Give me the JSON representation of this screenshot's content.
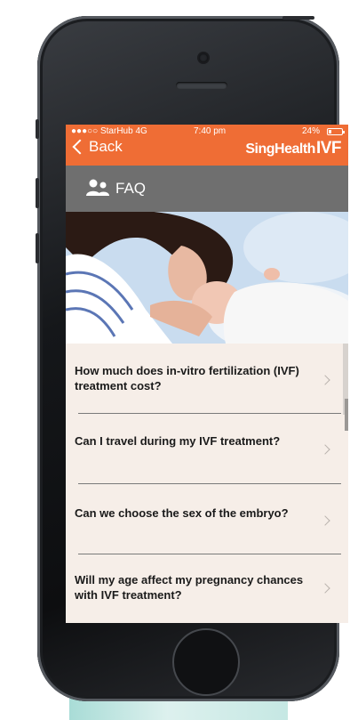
{
  "status_bar": {
    "carrier": "●●●○○ StarHub  4G",
    "time": "7:40 pm",
    "battery": "24%",
    "battery_level": 0.24
  },
  "header": {
    "back_label": "Back",
    "brand_prefix": "SingHealth",
    "brand_suffix": "IVF",
    "accent_color": "#ef6d35"
  },
  "section": {
    "title": "FAQ",
    "icon": "people-icon",
    "bar_color": "#6f6f6f"
  },
  "hero": {
    "description_icon": "mother-baby-photo"
  },
  "faq": {
    "items": [
      {
        "question": "How much does in-vitro fertilization (IVF) treatment cost?"
      },
      {
        "question": "Can I travel during my IVF treatment?"
      },
      {
        "question": "Can we choose the sex of the embryo?"
      },
      {
        "question": "Will my age affect my pregnancy chances with IVF treatment?"
      }
    ]
  }
}
